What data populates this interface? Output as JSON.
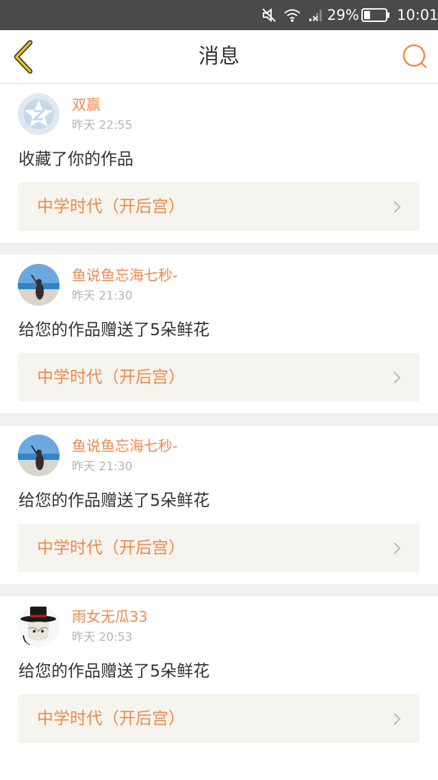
{
  "status_bar": {
    "battery_percent": "29%",
    "time": "10:01",
    "icons": [
      "muted-speaker-icon",
      "wifi-icon",
      "no-signal-icon",
      "battery-icon"
    ],
    "battery_level": 0.29
  },
  "nav": {
    "title": "消息",
    "back_icon": "chevron-left-icon",
    "search_icon": "search-icon",
    "accent_color": "#f0894a",
    "back_color": "#e8c21a"
  },
  "messages": [
    {
      "user": "双赢",
      "time": "昨天 22:55",
      "text": "收藏了你的作品",
      "work": "中学时代（开后宫）",
      "avatar": "default-avatar-icon"
    },
    {
      "user": "鱼说鱼忘海七秒-",
      "time": "昨天 21:30",
      "text": "给您的作品赠送了5朵鲜花",
      "work": "中学时代（开后宫）",
      "avatar": "beach-photo-avatar"
    },
    {
      "user": "鱼说鱼忘海七秒-",
      "time": "昨天 21:30",
      "text": "给您的作品赠送了5朵鲜花",
      "work": "中学时代（开后宫）",
      "avatar": "beach-photo-avatar"
    },
    {
      "user": "雨女无瓜33",
      "time": "昨天 20:53",
      "text": "给您的作品赠送了5朵鲜花",
      "work": "中学时代（开后宫）",
      "avatar": "top-hat-character-avatar"
    }
  ]
}
